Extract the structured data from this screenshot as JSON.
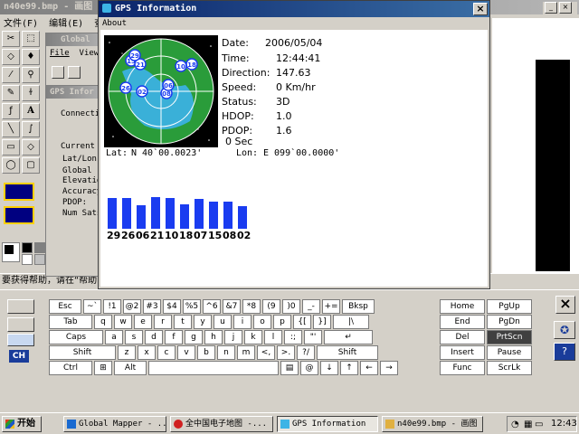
{
  "paint": {
    "title": "n40e99.bmp - 画图",
    "menu": [
      "文件(F)",
      "编辑(E)",
      "查看"
    ],
    "status": "要获得帮助，请在“帮助"
  },
  "global_mapper": {
    "title": "Global",
    "menu": [
      "File",
      "View"
    ],
    "sub_title": "GPS Infor",
    "labels": [
      "Connecti",
      "Current",
      "Lat/Lon",
      "Global",
      "Elevatio",
      "Accuracy",
      "PDOP:",
      "Num Sats"
    ]
  },
  "gps": {
    "title": "GPS Information",
    "menu_about": "About",
    "date_label": "Date:",
    "date_value": "2006/05/04",
    "time_label": "Time:",
    "time_value": "12:44:41",
    "direction_label": "Direction:",
    "direction_value": "147.63",
    "speed_label": "Speed:",
    "speed_value": "0 Km/hr",
    "status_label": "Status:",
    "status_value": "3D",
    "hdop_label": "HDOP:",
    "hdop_value": "1.0",
    "pdop_label": "PDOP:",
    "pdop_value": "1.6",
    "sec_value": "0 Sec",
    "lat_label": "Lat:",
    "lat_value": "N   40`00.0023'",
    "lon_label": "Lon:",
    "lon_value": "E  099`00.0000'",
    "sky_sats": [
      "15",
      "21",
      "29",
      "10",
      "18",
      "26",
      "02",
      "08",
      "06"
    ],
    "colors": {
      "bar": "#1a3cf0",
      "sky": "#2a9c3a",
      "space": "#000000"
    }
  },
  "signal_bars": {
    "prns": [
      "29",
      "26",
      "06",
      "21",
      "10",
      "18",
      "07",
      "15",
      "08",
      "02"
    ],
    "levels": [
      0.85,
      0.85,
      0.65,
      0.87,
      0.85,
      0.67,
      0.82,
      0.75,
      0.75,
      0.62
    ]
  },
  "keyboard": {
    "rows": [
      [
        "Esc",
        "~`",
        "!1",
        "@2",
        "#3",
        "$4",
        "%5",
        "^6",
        "&7",
        "*8",
        "(9",
        ")0",
        "_-",
        "+=",
        "Bksp"
      ],
      [
        "Tab",
        "q",
        "w",
        "e",
        "r",
        "t",
        "y",
        "u",
        "i",
        "o",
        "p",
        "{[",
        "}]",
        "|\\"
      ],
      [
        "Caps",
        "a",
        "s",
        "d",
        "f",
        "g",
        "h",
        "j",
        "k",
        "l",
        ":;",
        "\"'",
        "↵"
      ],
      [
        "Shift",
        "z",
        "x",
        "c",
        "v",
        "b",
        "n",
        "m",
        "<,",
        ">.",
        "?/",
        "Shift"
      ],
      [
        "Ctrl",
        "win",
        "Alt",
        "",
        "menu",
        "@",
        "↓",
        "↑",
        "←",
        "→"
      ]
    ],
    "nav": [
      [
        "Home",
        "PgUp"
      ],
      [
        "End",
        "PgDn"
      ],
      [
        "Del",
        "PrtScn"
      ],
      [
        "Insert",
        "Pause"
      ],
      [
        "Func",
        "ScrLk"
      ]
    ],
    "lang": "CH"
  },
  "taskbar": {
    "start": "开始",
    "buttons": [
      "Global Mapper - ...",
      "全中国电子地图 -...",
      "GPS Information",
      "n40e99.bmp - 画图"
    ],
    "clock": "12:43"
  }
}
